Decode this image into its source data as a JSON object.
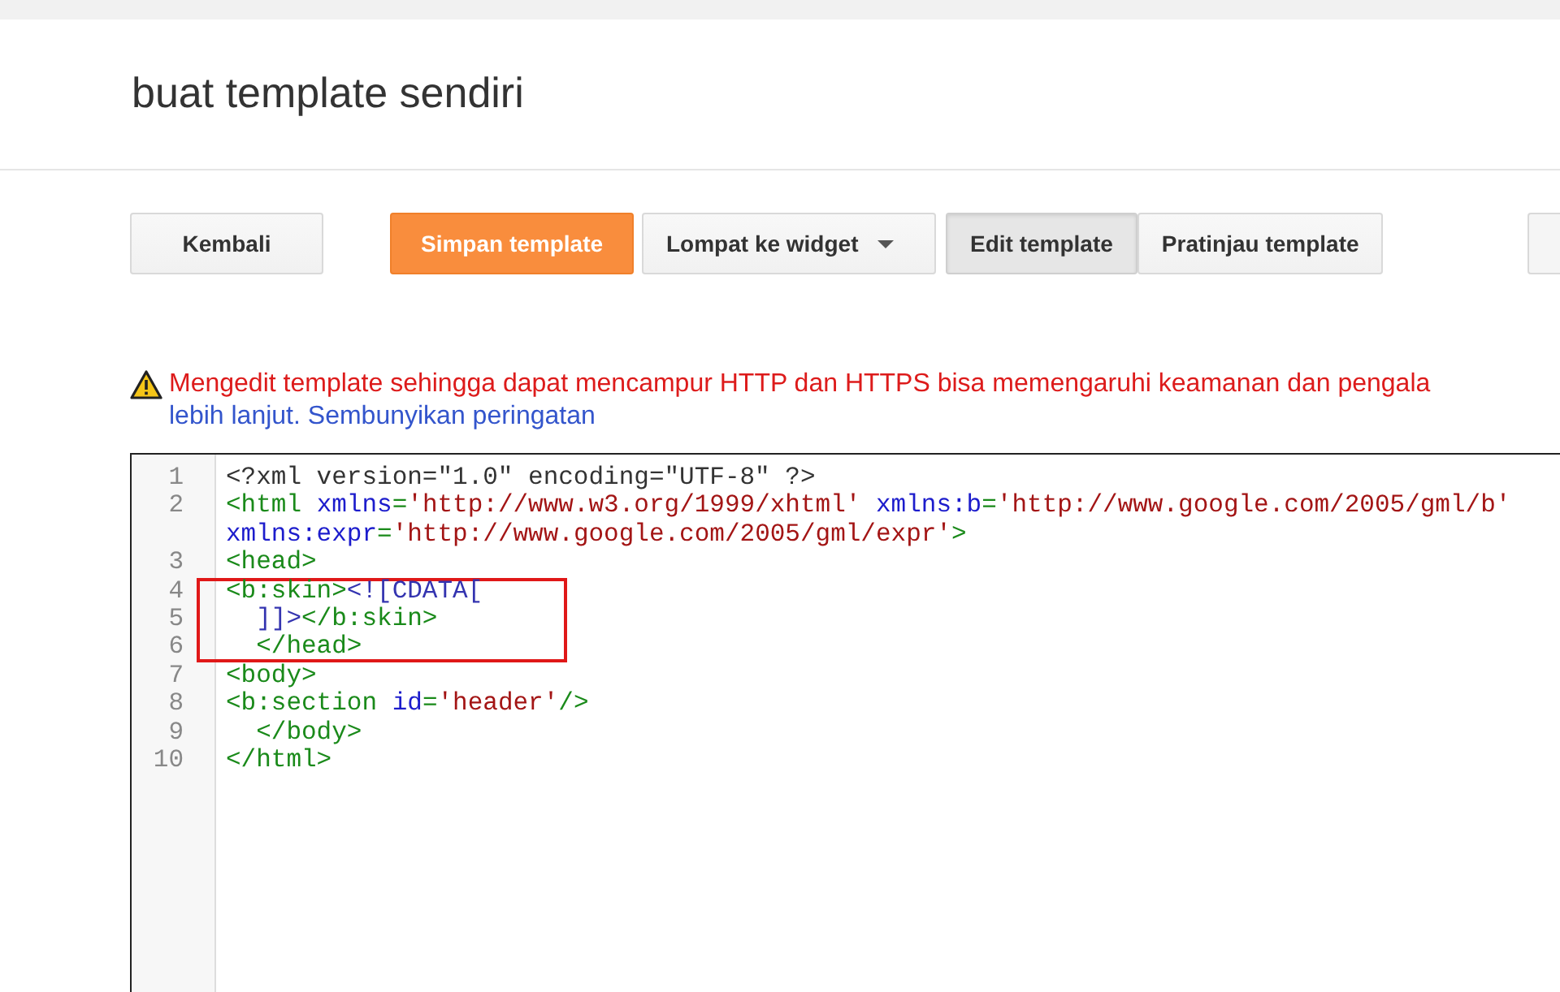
{
  "page": {
    "title": "buat template sendiri"
  },
  "toolbar": {
    "buttons": [
      {
        "label": "Kembali",
        "kind": "plain"
      },
      {
        "label": "Simpan template",
        "kind": "primary"
      },
      {
        "label": "Lompat ke widget",
        "kind": "dropdown"
      }
    ],
    "mode_tabs": [
      {
        "label": "Edit template",
        "selected": true
      },
      {
        "label": "Pratinjau template",
        "selected": false
      }
    ]
  },
  "warning": {
    "text": "Mengedit template sehingga dapat mencampur HTTP dan HTTPS bisa memengaruhi keamanan dan pengala",
    "text_continued": "lebih lanjut.",
    "link": "Sembunyikan peringatan"
  },
  "editor": {
    "lines": [
      {
        "kind": "line",
        "number": "1",
        "highlighted": false,
        "segments": [
          {
            "kind": "plain",
            "text": "<?xml version=\"1.0\" encoding=\"UTF-8\" ?>"
          }
        ]
      },
      {
        "kind": "line",
        "number": "2",
        "highlighted": false,
        "segments": [
          {
            "kind": "tag",
            "text": "<html "
          },
          {
            "kind": "attr",
            "text": "xmlns"
          },
          {
            "kind": "tag",
            "text": "="
          },
          {
            "kind": "string",
            "text": "'http://www.w3.org/1999/xhtml'"
          },
          {
            "kind": "attr",
            "text": " xmlns:b"
          },
          {
            "kind": "tag",
            "text": "="
          },
          {
            "kind": "string",
            "text": "'http://www.google.com/2005/gml/b'"
          }
        ]
      },
      {
        "kind": "wrap",
        "highlighted": false,
        "segments": [
          {
            "kind": "attr",
            "text": "xmlns:expr"
          },
          {
            "kind": "tag",
            "text": "="
          },
          {
            "kind": "string",
            "text": "'http://www.google.com/2005/gml/expr'"
          },
          {
            "kind": "tag",
            "text": ">"
          }
        ]
      },
      {
        "kind": "line",
        "number": "3",
        "highlighted": false,
        "segments": [
          {
            "kind": "tag",
            "text": "<head>"
          }
        ]
      },
      {
        "kind": "line",
        "number": "4",
        "highlighted": true,
        "segments": [
          {
            "kind": "tag",
            "text": "<b:skin>"
          },
          {
            "kind": "cdata",
            "text": "<![CDATA["
          }
        ]
      },
      {
        "kind": "line",
        "number": "5",
        "highlighted": true,
        "segments": [
          {
            "kind": "cdata",
            "text": "  ]]>"
          },
          {
            "kind": "tag",
            "text": "</b:skin>"
          }
        ]
      },
      {
        "kind": "line",
        "number": "6",
        "highlighted": true,
        "segments": [
          {
            "kind": "tag",
            "text": "  </head>"
          }
        ]
      },
      {
        "kind": "line",
        "number": "7",
        "highlighted": false,
        "segments": [
          {
            "kind": "tag",
            "text": "<body>"
          }
        ]
      },
      {
        "kind": "line",
        "number": "8",
        "highlighted": false,
        "segments": [
          {
            "kind": "tag",
            "text": "<b:section "
          },
          {
            "kind": "attr",
            "text": "id"
          },
          {
            "kind": "tag",
            "text": "="
          },
          {
            "kind": "string",
            "text": "'header'"
          },
          {
            "kind": "tag",
            "text": "/>"
          }
        ]
      },
      {
        "kind": "line",
        "number": "9",
        "highlighted": false,
        "segments": [
          {
            "kind": "tag",
            "text": "  </body>"
          }
        ]
      },
      {
        "kind": "line",
        "number": "10",
        "highlighted": false,
        "segments": [
          {
            "kind": "tag",
            "text": "</html>"
          }
        ]
      }
    ]
  }
}
